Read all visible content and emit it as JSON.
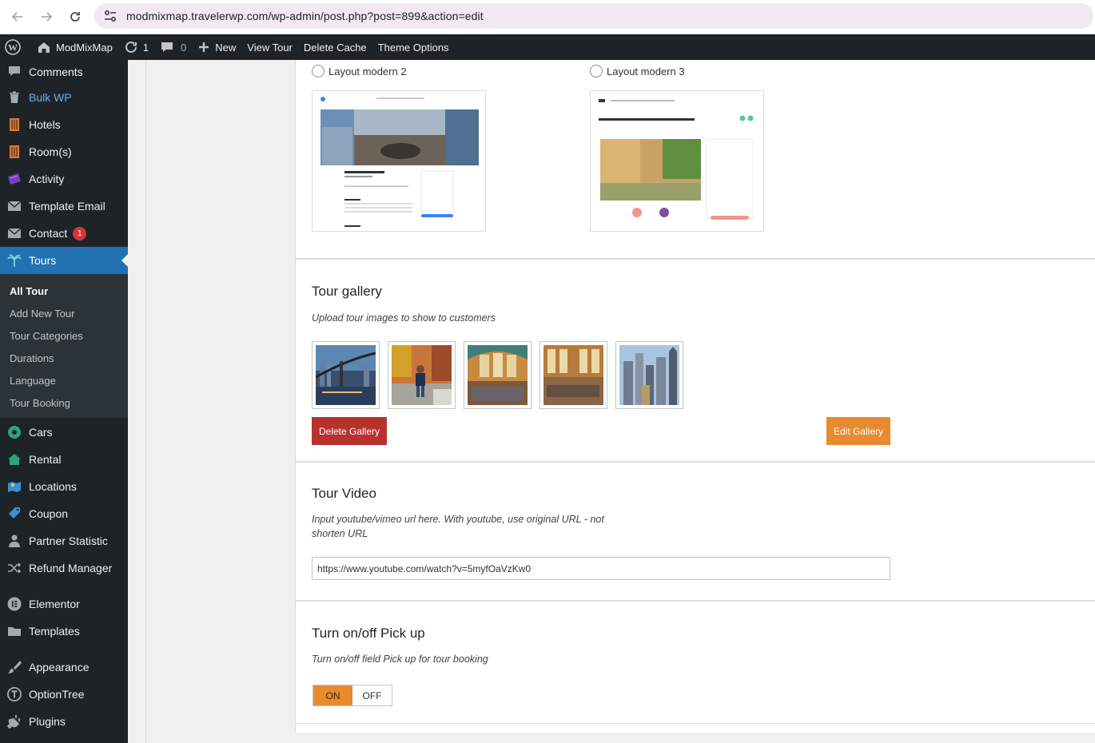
{
  "browser": {
    "url": "modmixmap.travelerwp.com/wp-admin/post.php?post=899&action=edit"
  },
  "admin_bar": {
    "site_name": "ModMixMap",
    "updates_count": "1",
    "comments_count": "0",
    "new_label": "New",
    "view_label": "View Tour",
    "delete_cache_label": "Delete Cache",
    "theme_options_label": "Theme Options"
  },
  "sidebar": {
    "items": [
      {
        "label": "Comments",
        "icon": "comment-icon"
      },
      {
        "label": "Bulk WP",
        "icon": "trash-icon"
      },
      {
        "label": "Hotels",
        "icon": "building-icon"
      },
      {
        "label": "Room(s)",
        "icon": "building-icon"
      },
      {
        "label": "Activity",
        "icon": "ticket-icon"
      },
      {
        "label": "Template Email",
        "icon": "mail-icon"
      },
      {
        "label": "Contact",
        "icon": "mail-icon",
        "badge": "1"
      },
      {
        "label": "Tours",
        "icon": "palm-icon"
      }
    ],
    "submenu": [
      "All Tour",
      "Add New Tour",
      "Tour Categories",
      "Durations",
      "Language",
      "Tour Booking"
    ],
    "items_after": [
      {
        "label": "Cars",
        "icon": "car-icon"
      },
      {
        "label": "Rental",
        "icon": "home-icon"
      },
      {
        "label": "Locations",
        "icon": "map-icon"
      },
      {
        "label": "Coupon",
        "icon": "tag-icon"
      },
      {
        "label": "Partner Statistic",
        "icon": "user-icon"
      },
      {
        "label": "Refund Manager",
        "icon": "shuffle-icon"
      },
      {
        "label": "Elementor",
        "icon": "elementor-icon"
      },
      {
        "label": "Templates",
        "icon": "folder-icon"
      },
      {
        "label": "Appearance",
        "icon": "brush-icon"
      },
      {
        "label": "OptionTree",
        "icon": "optiontree-icon"
      },
      {
        "label": "Plugins",
        "icon": "plug-icon"
      }
    ]
  },
  "layouts": {
    "modern2_label": "Layout modern 2",
    "modern3_label": "Layout modern 3"
  },
  "gallery": {
    "title": "Tour gallery",
    "description": "Upload tour images to show to customers",
    "images": [
      "bridge-city-night",
      "person-autumn-park",
      "grand-central-hall",
      "grand-central-hall-2",
      "city-skyline-aerial"
    ],
    "delete_label": "Delete Gallery",
    "edit_label": "Edit Gallery"
  },
  "video": {
    "title": "Tour Video",
    "description_line1": "Input youtube/vimeo url here. With youtube, use original URL - not",
    "description_line2": "shorten URL",
    "url_value": "https://www.youtube.com/watch?v=5myfOaVzKw0"
  },
  "pickup": {
    "title": "Turn on/off Pick up",
    "description": "Turn on/off field Pick up for tour booking",
    "on_label": "ON",
    "off_label": "OFF",
    "value": "ON"
  },
  "colors": {
    "admin_dark": "#1d2327",
    "accent_blue": "#2271b1",
    "delete_red": "#b8322d",
    "edit_orange": "#ea8a2e"
  }
}
